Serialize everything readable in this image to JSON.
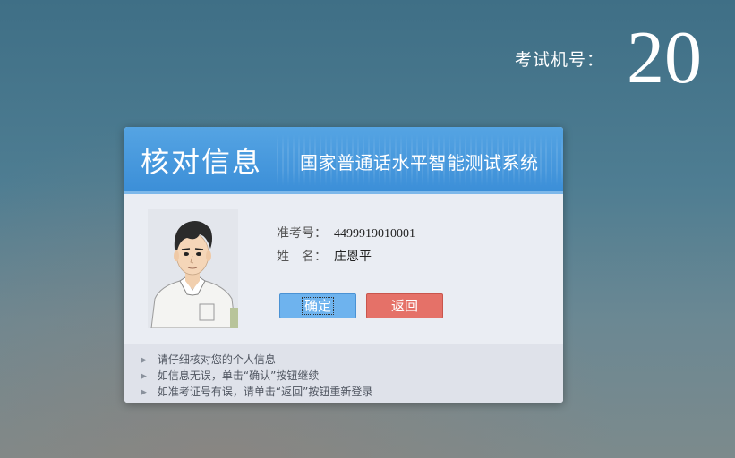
{
  "machine": {
    "label": "考试机号：",
    "number": "20"
  },
  "card": {
    "title": "核对信息",
    "subtitle": "国家普通话水平智能测试系统",
    "fields": [
      {
        "label": "准考号：",
        "value": "4499919010001"
      },
      {
        "label": "姓　名：",
        "value": "庄恩平"
      }
    ],
    "confirm_label": "确定",
    "back_label": "返回",
    "tips": [
      "请仔细核对您的个人信息",
      "如信息无误，单击“确认”按钮继续",
      "如准考证号有误，请单击“返回”按钮重新登录"
    ]
  },
  "icons": {
    "tip_bullet": "triangle-right-icon",
    "photo": "student-avatar"
  },
  "colors": {
    "header": "#4a9ae0",
    "confirm": "#6eb3ee",
    "back": "#e57168",
    "card": "#eaedf3"
  }
}
